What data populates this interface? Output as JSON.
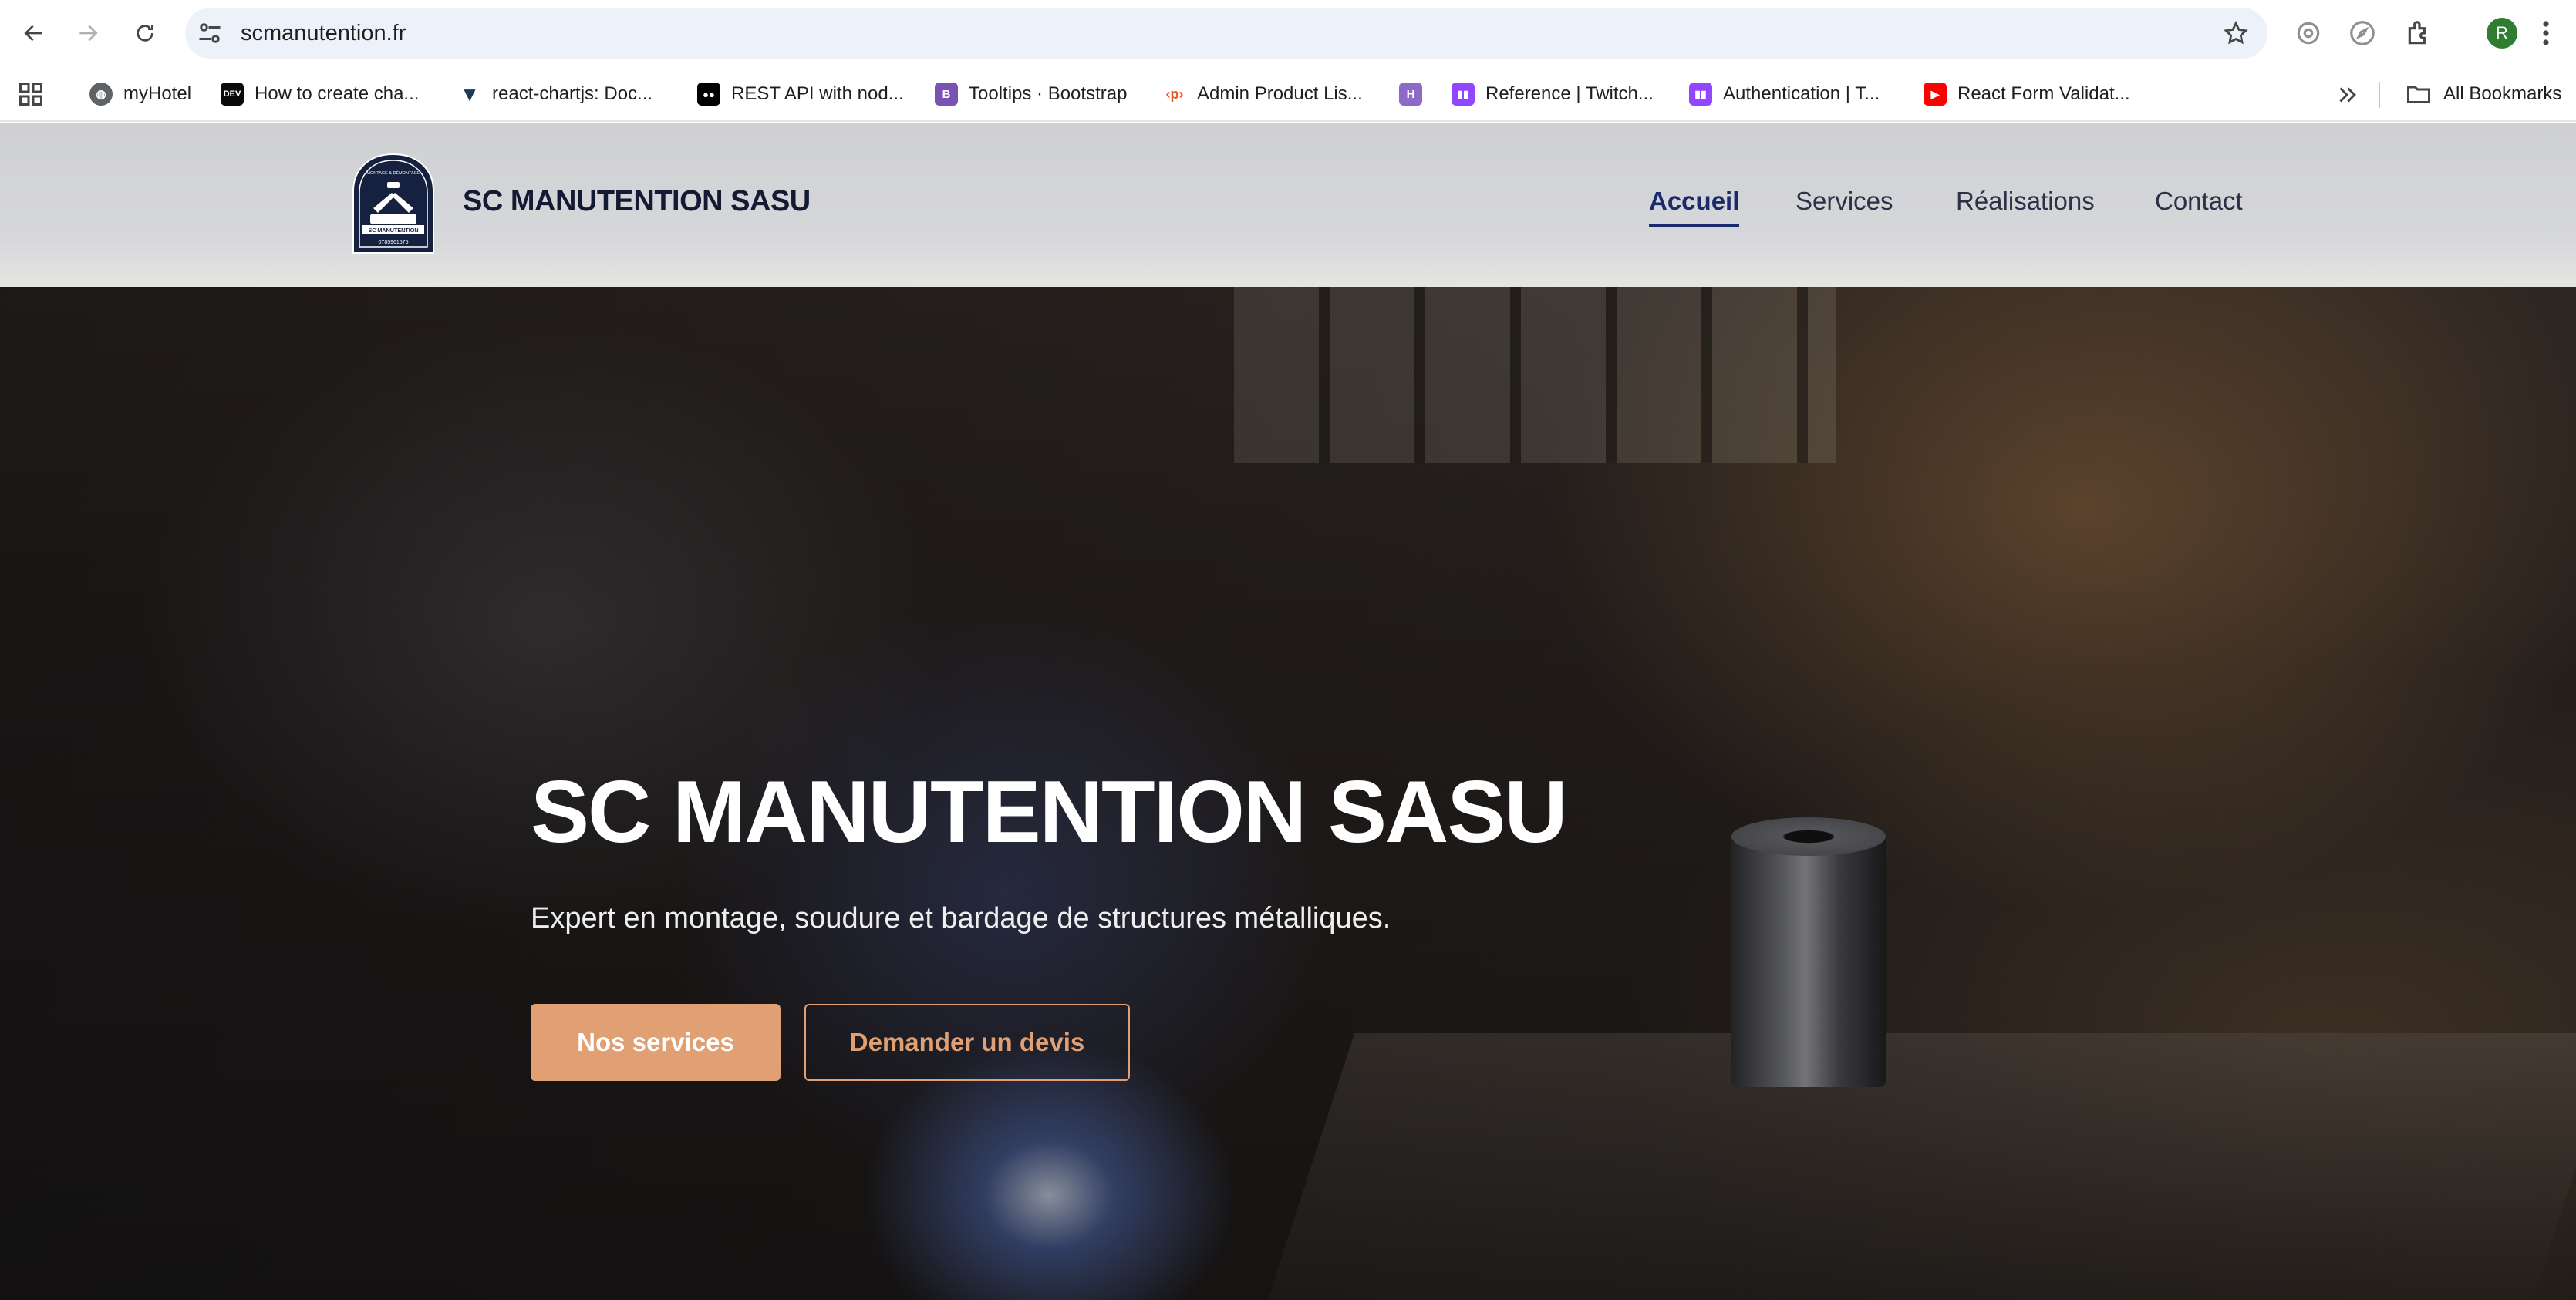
{
  "browser": {
    "url": "scmanutention.fr",
    "profile_initial": "R",
    "bookmarks": [
      {
        "label": "myHotel",
        "icon": "globe-icon"
      },
      {
        "label": "How to create cha...",
        "icon": "dev-icon",
        "icon_text": "DEV"
      },
      {
        "label": "react-chartjs: Doc...",
        "icon": "vuetify-icon"
      },
      {
        "label": "REST API with nod...",
        "icon": "medium-icon",
        "icon_text": "●●"
      },
      {
        "label": "Tooltips · Bootstrap",
        "icon": "bootstrap-icon",
        "icon_text": "B"
      },
      {
        "label": "Admin Product Lis...",
        "icon": "tag-icon",
        "icon_text": "‹p›"
      },
      {
        "label": "",
        "icon": "h-icon",
        "icon_text": "H"
      },
      {
        "label": "Reference | Twitch...",
        "icon": "twitch-icon"
      },
      {
        "label": "Authentication | T...",
        "icon": "twitch-icon"
      },
      {
        "label": "React Form Validat...",
        "icon": "youtube-icon"
      }
    ],
    "all_bookmarks": "All Bookmarks"
  },
  "header": {
    "brand": "SC MANUTENTION SASU",
    "logo": {
      "top_text": "MONTAGE & DÉMONTAGE",
      "name": "SC MANUTENTION",
      "phone": "0785961575"
    },
    "nav": [
      {
        "label": "Accueil",
        "active": true
      },
      {
        "label": "Services",
        "active": false
      },
      {
        "label": "Réalisations",
        "active": false
      },
      {
        "label": "Contact",
        "active": false
      }
    ]
  },
  "hero": {
    "title": "SC MANUTENTION SASU",
    "subtitle": "Expert en montage, soudure et bardage de structures métalliques.",
    "primary_button": "Nos services",
    "secondary_button": "Demander un devis"
  },
  "colors": {
    "accent": "#e0a074",
    "nav_active": "#1b2a6b",
    "brand_text": "#141a33"
  }
}
